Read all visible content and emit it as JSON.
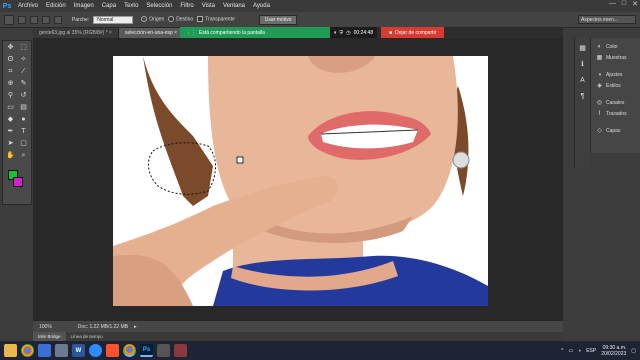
{
  "app": {
    "logo": "Ps",
    "menu": [
      "Archivo",
      "Edición",
      "Imagen",
      "Capa",
      "Texto",
      "Selección",
      "Filtro",
      "Vista",
      "Ventana",
      "Ayuda"
    ]
  },
  "window_controls": {
    "minimize": "—",
    "maximize": "□",
    "close": "✕"
  },
  "options": {
    "feather_label": "Parche:",
    "mode_value": "Normal",
    "source_label": "Origen",
    "dest_label": "Destino",
    "transparent_label": "Transparente",
    "pattern_button": "Usar motivo",
    "workspace": "Aspectos esen..."
  },
  "share": {
    "message": "Está compartiendo la pantalla",
    "timer": "00:24:48",
    "stop": "Dejar de compartir"
  },
  "doc_tabs": [
    {
      "label": "gente63.jpg al 35% (RGB/8#) *",
      "close": "×"
    },
    {
      "label": "selección-en-una-esp",
      "close": "×"
    }
  ],
  "status": {
    "zoom": "100%",
    "doc": "Doc: 1.22 MB/1.22 MB"
  },
  "bottom_tabs": [
    "Mini Bridge",
    "Línea de tiempo"
  ],
  "panels": [
    {
      "label": "Color",
      "icon": "color-icon"
    },
    {
      "label": "Muestras",
      "icon": "swatches-icon"
    },
    {
      "label": "Ajustes",
      "icon": "adjustments-icon"
    },
    {
      "label": "Estilos",
      "icon": "styles-icon"
    },
    {
      "label": "Canales",
      "icon": "channels-icon"
    },
    {
      "label": "Trazados",
      "icon": "paths-icon"
    },
    {
      "label": "Capas",
      "icon": "layers-icon"
    }
  ],
  "colors": {
    "foreground": "#16c32d",
    "background": "#d321cf",
    "share_green": "#1f9b56",
    "share_red": "#d93b30"
  },
  "taskbar": {
    "apps": [
      "explorer",
      "chrome",
      "app",
      "app",
      "word",
      "zoom",
      "brave",
      "chrome",
      "photoshop",
      "app",
      "app"
    ],
    "lang": "ESP",
    "time": "09:30 a.m.",
    "date": "20/02/2023"
  }
}
